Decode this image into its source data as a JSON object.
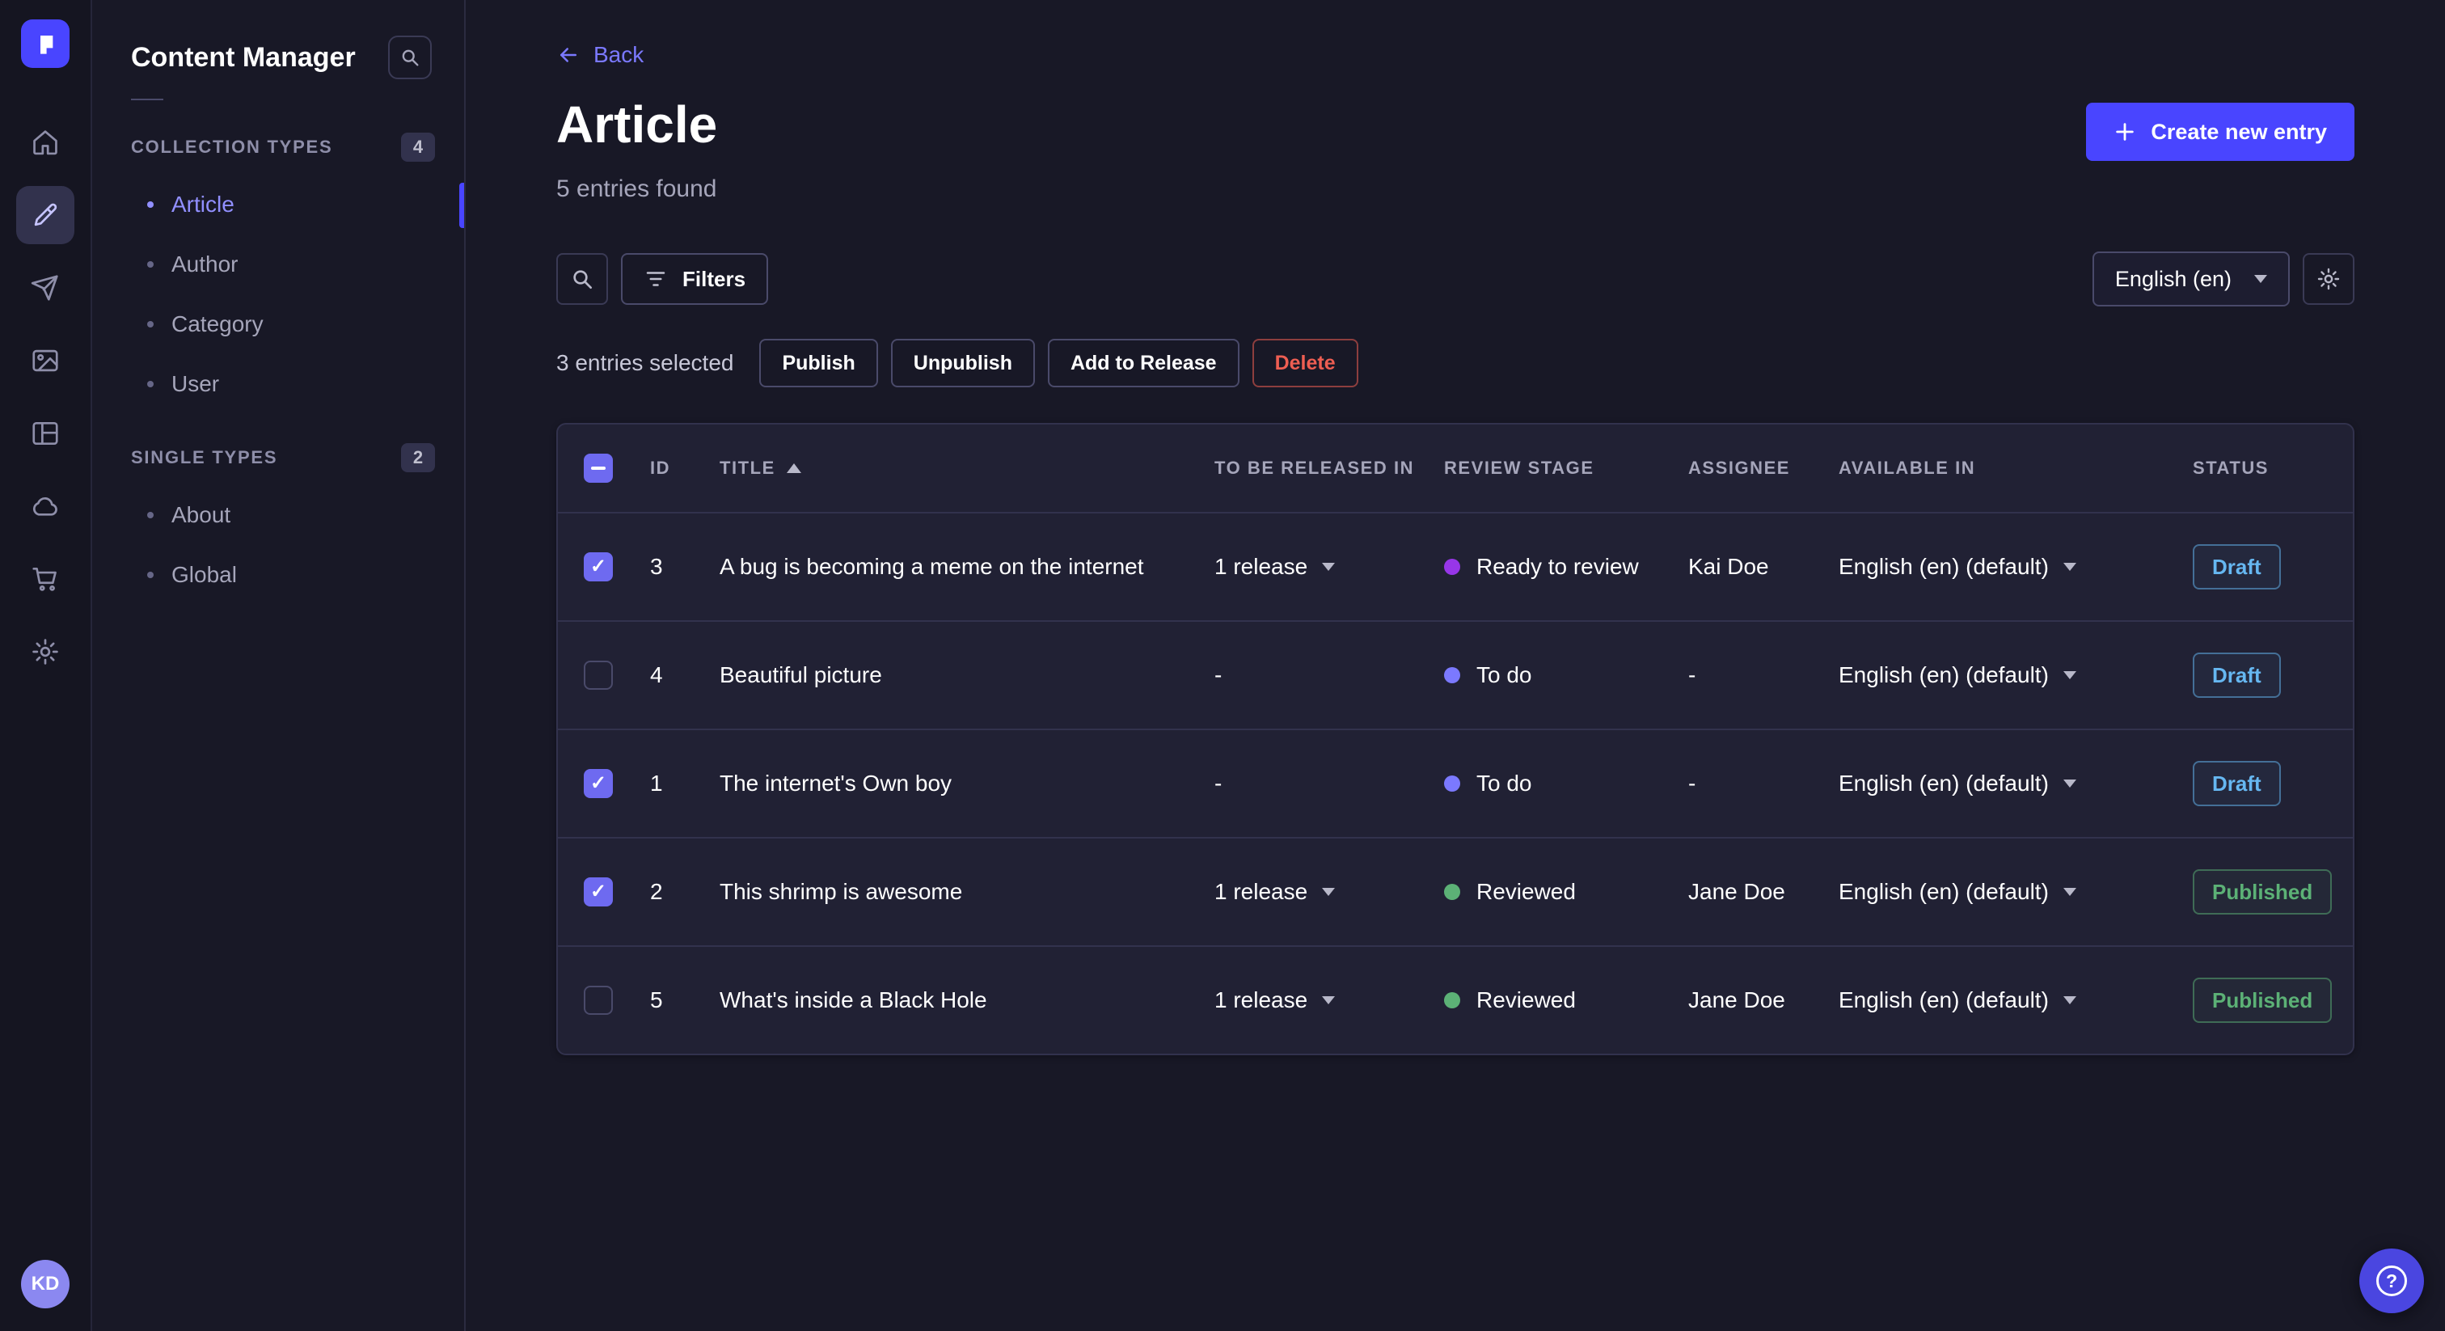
{
  "colors": {
    "primary": "#4945ff",
    "primary_light": "#7b79ff",
    "background": "#181826",
    "surface": "#212134",
    "border": "#32324d",
    "danger": "#ee5e52",
    "success": "#5cb176",
    "secondary_blue": "#66b7f1",
    "alternative_purple": "#9736e8",
    "text_secondary": "#a5a5ba"
  },
  "rail": {
    "icons": [
      {
        "id": "home",
        "active": false
      },
      {
        "id": "content-manager",
        "active": true
      },
      {
        "id": "releases",
        "active": false
      },
      {
        "id": "media-library",
        "active": false
      },
      {
        "id": "content-type-builder",
        "active": false
      },
      {
        "id": "cloud",
        "active": false
      },
      {
        "id": "marketplace",
        "active": false
      },
      {
        "id": "settings",
        "active": false
      }
    ],
    "avatar_initials": "KD"
  },
  "sidebar": {
    "title": "Content Manager",
    "sections": [
      {
        "label": "COLLECTION TYPES",
        "badge": "4",
        "items": [
          {
            "label": "Article",
            "active": true
          },
          {
            "label": "Author",
            "active": false
          },
          {
            "label": "Category",
            "active": false
          },
          {
            "label": "User",
            "active": false
          }
        ]
      },
      {
        "label": "SINGLE TYPES",
        "badge": "2",
        "items": [
          {
            "label": "About",
            "active": false
          },
          {
            "label": "Global",
            "active": false
          }
        ]
      }
    ]
  },
  "header": {
    "back_label": "Back",
    "title": "Article",
    "subtitle": "5 entries found",
    "create_label": "Create new entry"
  },
  "toolbar": {
    "filters_label": "Filters",
    "locale_value": "English (en)"
  },
  "selection": {
    "text": "3 entries selected",
    "actions": [
      {
        "label": "Publish",
        "danger": false
      },
      {
        "label": "Unpublish",
        "danger": false
      },
      {
        "label": "Add to Release",
        "danger": false
      },
      {
        "label": "Delete",
        "danger": true
      }
    ]
  },
  "table": {
    "headers": {
      "id": "ID",
      "title": "TITLE",
      "release": "TO BE RELEASED IN",
      "review": "REVIEW STAGE",
      "assignee": "ASSIGNEE",
      "available": "AVAILABLE IN",
      "status": "STATUS"
    },
    "sort_column": "TITLE",
    "sort_direction": "asc",
    "status_styles": {
      "Draft": {
        "color": "#66b7f1",
        "border": "rgba(102,183,241,0.5)",
        "bg": "rgba(102,183,241,0.05)"
      },
      "Published": {
        "color": "#5cb176",
        "border": "rgba(92,177,118,0.5)",
        "bg": "rgba(92,177,118,0.05)"
      }
    },
    "rows": [
      {
        "checked": true,
        "id": "3",
        "title": "A bug is becoming a meme on the internet",
        "release": "1 release",
        "release_menu": true,
        "review_stage": "Ready to review",
        "review_color": "#9736e8",
        "assignee": "Kai Doe",
        "available_in": "English (en) (default)",
        "status": "Draft"
      },
      {
        "checked": false,
        "id": "4",
        "title": "Beautiful picture",
        "release": "-",
        "release_menu": false,
        "review_stage": "To do",
        "review_color": "#7b79ff",
        "assignee": "-",
        "available_in": "English (en) (default)",
        "status": "Draft"
      },
      {
        "checked": true,
        "id": "1",
        "title": "The internet's Own boy",
        "release": "-",
        "release_menu": false,
        "review_stage": "To do",
        "review_color": "#7b79ff",
        "assignee": "-",
        "available_in": "English (en) (default)",
        "status": "Draft"
      },
      {
        "checked": true,
        "id": "2",
        "title": "This shrimp is awesome",
        "release": "1 release",
        "release_menu": true,
        "review_stage": "Reviewed",
        "review_color": "#5cb176",
        "assignee": "Jane Doe",
        "available_in": "English (en) (default)",
        "status": "Published"
      },
      {
        "checked": false,
        "id": "5",
        "title": "What's inside a Black Hole",
        "release": "1 release",
        "release_menu": true,
        "review_stage": "Reviewed",
        "review_color": "#5cb176",
        "assignee": "Jane Doe",
        "available_in": "English (en) (default)",
        "status": "Published"
      }
    ]
  }
}
